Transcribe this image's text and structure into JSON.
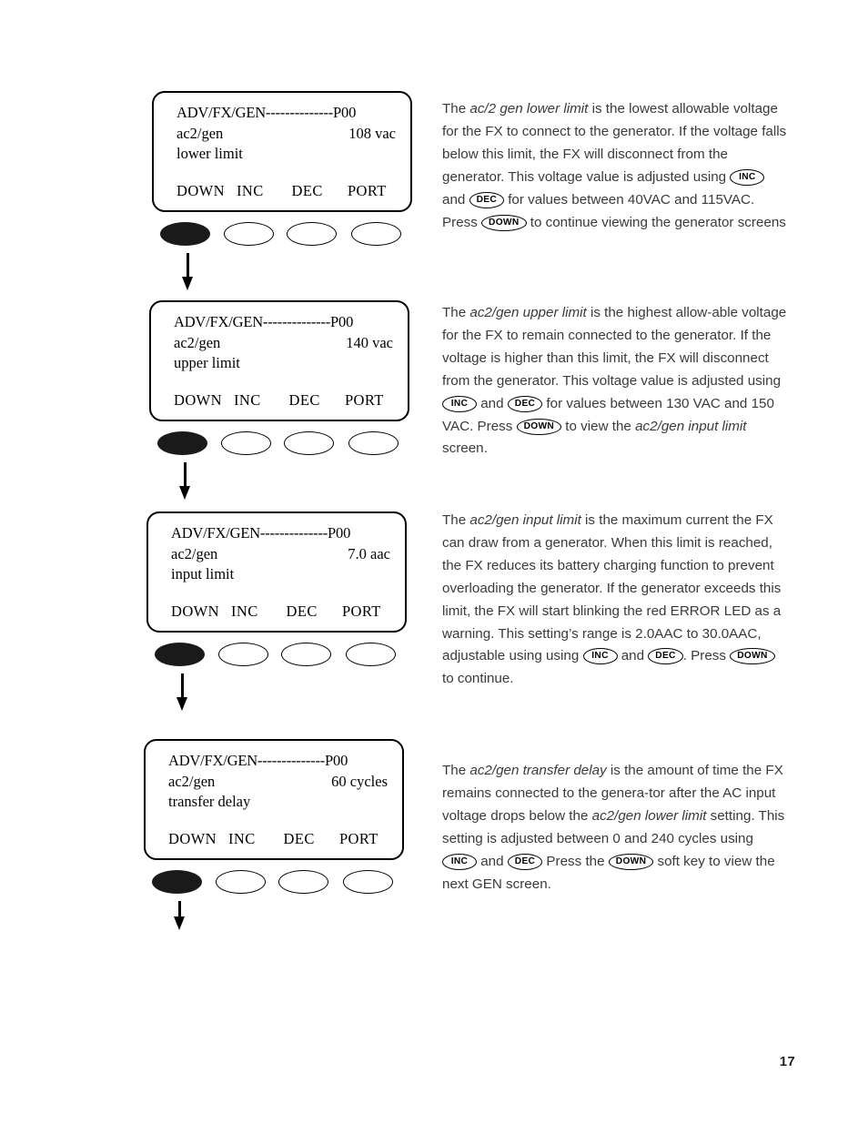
{
  "page": {
    "number": "17"
  },
  "screens": [
    {
      "header_label": "ADV/FX/GEN",
      "header_dashes": "--------------",
      "header_code": "P00",
      "line1_label": "ac2/gen",
      "line1_value": "108 vac",
      "line2_label": "lower limit",
      "softkeys": [
        "DOWN",
        "INC",
        "DEC",
        "PORT"
      ],
      "active_softkey": "DOWN"
    },
    {
      "header_label": "ADV/FX/GEN",
      "header_dashes": "--------------",
      "header_code": "P00",
      "line1_label": "ac2/gen",
      "line1_value": "140 vac",
      "line2_label": "upper limit",
      "softkeys": [
        "DOWN",
        "INC",
        "DEC",
        "PORT"
      ],
      "active_softkey": "DOWN"
    },
    {
      "header_label": "ADV/FX/GEN",
      "header_dashes": "--------------",
      "header_code": "P00",
      "line1_label": "ac2/gen",
      "line1_value": "7.0 aac",
      "line2_label": "input limit",
      "softkeys": [
        "DOWN",
        "INC",
        "DEC",
        "PORT"
      ],
      "active_softkey": "DOWN"
    },
    {
      "header_label": "ADV/FX/GEN",
      "header_dashes": "--------------",
      "header_code": "P00",
      "line1_label": "ac2/gen",
      "line1_value": "60 cycles",
      "line2_label": "transfer delay",
      "softkeys": [
        "DOWN",
        "INC",
        "DEC",
        "PORT"
      ],
      "active_softkey": "DOWN"
    }
  ],
  "paragraphs": [
    {
      "seg1": "The ",
      "term": "ac/2 gen lower limit",
      "seg2": " is the lowest allowable voltage for the FX to connect to the generator. If the voltage falls below this limit, the FX will disconnect from the generator. This voltage value is adjusted using ",
      "key1": "INC",
      "seg3": " and ",
      "key2": "DEC",
      "seg4": " for values between 40VAC and 115VAC. Press ",
      "key3": "DOWN",
      "seg5": " to continue viewing the generator screens"
    },
    {
      "seg1": "The ",
      "term": "ac2/gen upper limit",
      "seg2": " is the highest allow-able voltage for the FX to remain connected to the generator. If the voltage is higher than this limit, the FX will disconnect from the generator. This voltage value is adjusted using ",
      "key1": "INC",
      "seg3": " and ",
      "key2": "DEC",
      "seg4": " for values between 130 VAC and 150 VAC. Press ",
      "key3": "DOWN",
      "seg5": " to view the ",
      "term2": "ac2/gen input limit",
      "seg6": " screen."
    },
    {
      "seg1": "The ",
      "term": "ac2/gen input limit",
      "seg2": " is the maximum current the FX can draw from a generator. When this limit is reached, the FX reduces its battery charging function to prevent overloading the generator. If the generator exceeds this limit, the FX will start blinking the red ERROR LED as a warning. This setting’s range is 2.0AAC to 30.0AAC, adjustable using using ",
      "key1": "INC",
      "seg3": " and ",
      "key2": "DEC",
      "seg4": ". Press ",
      "key3": "DOWN",
      "seg5": " to continue."
    },
    {
      "seg1": "The ",
      "term": "ac2/gen transfer delay",
      "seg2": " is the amount of time the FX remains connected to the genera-tor after the AC input voltage drops below the ",
      "term2": "ac2/gen lower limit",
      "seg2b": " setting. This setting is adjusted between 0 and 240 cycles  using ",
      "key1": "INC",
      "seg3": " and ",
      "key2": "DEC",
      "seg4": " Press the ",
      "key3": "DOWN",
      "seg5": " soft key to view the next GEN screen."
    }
  ]
}
